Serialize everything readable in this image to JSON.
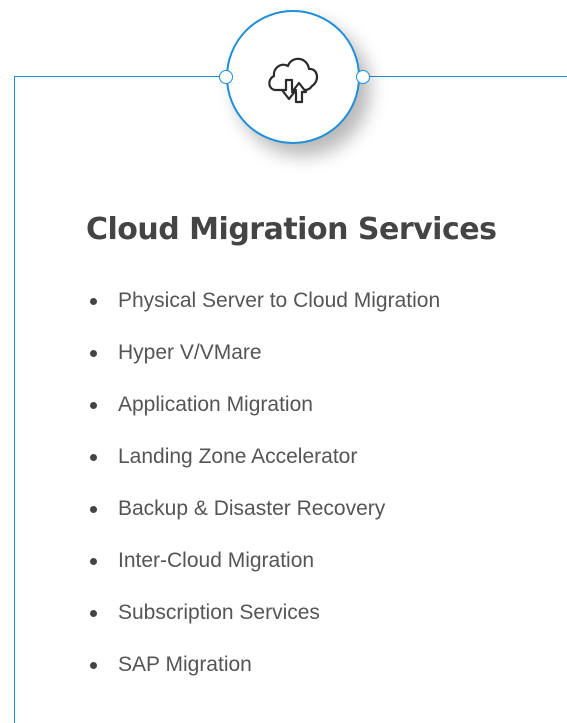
{
  "icon": {
    "name": "cloud-upload-download-icon"
  },
  "colors": {
    "accent": "#1f8fd8",
    "text": "#555555",
    "heading": "#444444"
  },
  "title": "Cloud Migration Services",
  "services": [
    "Physical Server to Cloud Migration",
    "Hyper V/VMare",
    "Application Migration",
    "Landing Zone Accelerator",
    "Backup & Disaster Recovery",
    "Inter-Cloud Migration",
    "Subscription Services",
    "SAP Migration"
  ]
}
